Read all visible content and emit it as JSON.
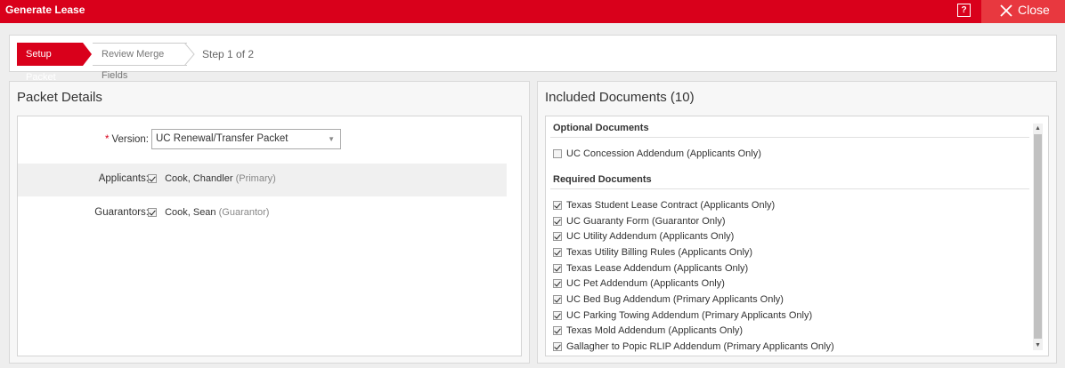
{
  "window": {
    "title": "Generate Lease",
    "help_label": "?",
    "close_label": "Close"
  },
  "steps": {
    "items": [
      {
        "label": "Setup Packet",
        "active": true
      },
      {
        "label": "Review Merge Fields",
        "active": false
      }
    ],
    "counter": "Step 1 of 2"
  },
  "packet_details": {
    "title": "Packet Details",
    "version_label": "Version:",
    "version_value": "UC Renewal/Transfer Packet",
    "applicants_label": "Applicants:",
    "applicant": {
      "name": "Cook, Chandler",
      "role": "(Primary)",
      "checked": true
    },
    "guarantors_label": "Guarantors:",
    "guarantor": {
      "name": "Cook, Sean",
      "role": "(Guarantor)",
      "checked": true
    }
  },
  "included_documents": {
    "title": "Included Documents (10)",
    "optional_title": "Optional Documents",
    "optional": [
      {
        "label": "UC Concession Addendum (Applicants Only)",
        "checked": false
      }
    ],
    "required_title": "Required Documents",
    "required": [
      {
        "label": "Texas Student Lease Contract (Applicants Only)",
        "checked": true
      },
      {
        "label": "UC Guaranty Form (Guarantor Only)",
        "checked": true
      },
      {
        "label": "UC Utility Addendum (Applicants Only)",
        "checked": true
      },
      {
        "label": "Texas Utility Billing Rules (Applicants Only)",
        "checked": true
      },
      {
        "label": "Texas Lease Addendum (Applicants Only)",
        "checked": true
      },
      {
        "label": "UC Pet Addendum (Applicants Only)",
        "checked": true
      },
      {
        "label": "UC Bed Bug Addendum (Primary Applicants Only)",
        "checked": true
      },
      {
        "label": "UC Parking Towing Addendum (Primary Applicants Only)",
        "checked": true
      },
      {
        "label": "Texas Mold Addendum (Applicants Only)",
        "checked": true
      },
      {
        "label": "Gallagher to Popic RLIP Addendum (Primary Applicants Only)",
        "checked": true
      }
    ]
  },
  "colors": {
    "brand_red": "#d9001b",
    "close_red": "#e8383f"
  }
}
